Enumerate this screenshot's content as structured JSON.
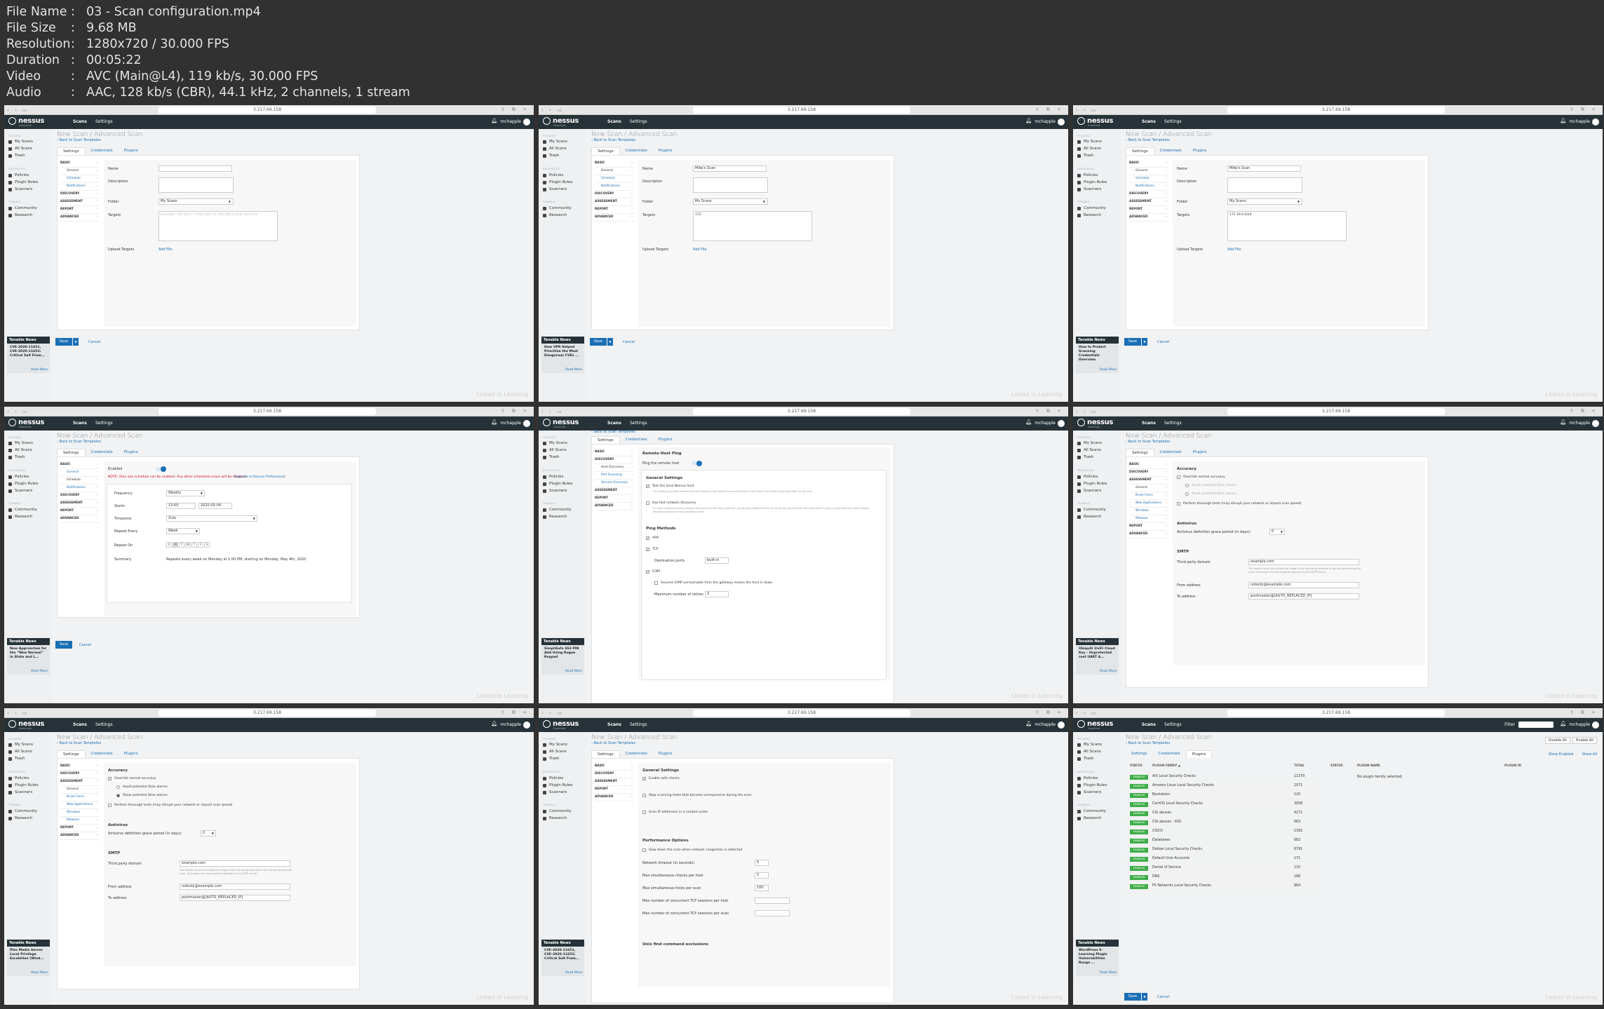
{
  "info": [
    {
      "k": "File Name",
      "v": "03 - Scan configuration.mp4"
    },
    {
      "k": "File Size",
      "v": "9.68 MB"
    },
    {
      "k": "Resolution",
      "v": "1280x720 / 30.000 FPS"
    },
    {
      "k": "Duration",
      "v": "00:05:22"
    },
    {
      "k": "Video",
      "v": "AVC (Main@L4), 119 kb/s, 30.000 FPS"
    },
    {
      "k": "Audio",
      "v": "AAC, 128 kb/s (CBR), 44.1 kHz, 2 channels, 1 stream"
    }
  ],
  "common": {
    "url": "3.217.69.158",
    "brand": "nessus",
    "brand_sub": "Essentials",
    "nav_scans": "Scans",
    "nav_settings": "Settings",
    "user": "mchapple",
    "filter": "Filter",
    "folders_h": "FOLDERS",
    "my_scans": "My Scans",
    "all_scans": "All Scans",
    "trash": "Trash",
    "resources_h": "RESOURCES",
    "policies": "Policies",
    "plugin_rules": "Plugin Rules",
    "scanners": "Scanners",
    "tenable_h": "TENABLE",
    "community": "Community",
    "research": "Research",
    "news_h": "Tenable News",
    "read_more": "Read More",
    "page_title": "New Scan / Advanced Scan",
    "back": "‹ Back to Scan Templates",
    "tab_settings": "Settings",
    "tab_credentials": "Credentials",
    "tab_plugins": "Plugins",
    "basic": "BASIC",
    "general": "General",
    "schedule": "Schedule",
    "notifications": "Notifications",
    "discovery": "DISCOVERY",
    "host_discovery": "Host Discovery",
    "port_scanning": "Port Scanning",
    "service_discovery": "Service Discovery",
    "assessment": "ASSESSMENT",
    "brute_force": "Brute Force",
    "web_apps": "Web Applications",
    "windows": "Windows",
    "malware": "Malware",
    "report": "REPORT",
    "advanced": "ADVANCED",
    "name_l": "Name",
    "desc_l": "Description",
    "folder_l": "Folder",
    "folder_v": "My Scans",
    "targets_l": "Targets",
    "targets_ph": "Example: 192.168.1.1-192.168.1.5, 192.168.2.0/24, test.com",
    "upload_l": "Upload Targets",
    "add_file": "Add File",
    "save": "Save",
    "cancel": "Cancel",
    "watermark": "Linked in Learning",
    "accuracy": "Accuracy",
    "override": "Override normal accuracy",
    "avoid_fa": "Avoid potential false alarms",
    "show_fa": "Show potential false alarms",
    "thorough": "Perform thorough tests (may disrupt your network or impact scan speed)",
    "antivirus": "Antivirus",
    "av_grace": "Antivirus definition grace period (in days):",
    "av_val": "0",
    "smtp": "SMTP",
    "third_party": "Third party domain",
    "third_party_v": "example.com",
    "smtp_note": "The domain must be outside the range of the site being scanned or the site performing the scan. Otherwise, the test might be aborted by the SMTP server.",
    "from_l": "From address",
    "from_v": "nobody@example.com",
    "to_l": "To address",
    "to_v": "postmaster@[AUTO_REPLACED_IP]"
  },
  "f1": {
    "news": "CVE-2020-11651, CVE-2020-11652: Critical Salt Fram..."
  },
  "f2": {
    "name_v": "Mike's Scan",
    "targets_v": "172",
    "news": "How VPR Helped Prioritize the Most Dangerous CVEs ..."
  },
  "f3": {
    "name_v": "Mike's Scan",
    "targets_v": "172.30.0.0/24",
    "news": "How to Protect Scanning Credentials Overview"
  },
  "f4": {
    "enabled": "Enabled",
    "warn": "NOTE: Only one schedule can be enabled. Any other scheduled scans will be disabled.",
    "upgrade": "Upgrade to Nessus Professional",
    "freq_l": "Frequency",
    "freq_v": "Weekly",
    "starts_l": "Starts",
    "starts_t": "13:00",
    "starts_d": "2020-05-04",
    "tz_l": "Timezone",
    "tz_v": "Zulu",
    "repeat_l": "Repeat Every",
    "repeat_v": "Week",
    "repeat_on_l": "Repeat On",
    "days": [
      "S",
      "M",
      "T",
      "W",
      "T",
      "F",
      "S"
    ],
    "summary_l": "Summary",
    "summary_v": "Repeats every week on Monday at 1:00 PM, starting on Monday, May 4th, 2020",
    "news": "New Approaches for the “New Normal” in State and L..."
  },
  "f5": {
    "rhp": "Remote Host Ping",
    "ping_remote": "Ping the remote host",
    "gen_settings": "General Settings",
    "test_local": "Test the local Nessus host",
    "test_local_note": "This setting specifies whether the local Nessus host should be scanned when it falls within the target range specified for the scan.",
    "fast_disc": "Use fast network discovery",
    "fast_note": "If a host responds to ping, Nessus attempts to avoid false positives, performing additional tests to verify the response did not come from a proxy or load balancer. Fast network discovery bypasses those additional tests.",
    "ping_methods": "Ping Methods",
    "arp": "ARP",
    "tcp": "TCP",
    "dest_ports": "Destination ports",
    "dest_ports_v": "built-in",
    "icmp": "ICMP",
    "assume_icmp": "Assume ICMP unreachable from the gateway means the host is down",
    "max_retries": "Maximum number of retries",
    "max_retries_v": "2",
    "news": "SimpliSafe SS3 PIN Add Using Rogue Keypad"
  },
  "f6": {
    "news": "Ubiquiti UniFi Cloud Key - Unprotected root UART A..."
  },
  "f7": {
    "news": "Plex Media Server Local Privilege Escalation (Wind..."
  },
  "f8": {
    "gen_settings": "General Settings",
    "safe_checks": "Enable safe checks",
    "stop_unresp": "Stop scanning hosts that become unresponsive during the scan",
    "random_order": "Scan IP addresses in a random order",
    "perf": "Performance Options",
    "slow_down": "Slow down the scan when network congestion is detected",
    "net_timeout": "Network timeout (in seconds)",
    "net_timeout_v": "5",
    "max_checks": "Max simultaneous checks per host",
    "max_checks_v": "5",
    "max_hosts": "Max simultaneous hosts per scan",
    "max_hosts_v": "100",
    "max_tcp_host": "Max number of concurrent TCP sessions per host",
    "max_tcp_scan": "Max number of concurrent TCP sessions per scan",
    "unix_excl": "Unix find command exclusions",
    "news": "CVE-2020-11651, CVE-2020-11652: Critical Salt Fram..."
  },
  "f9": {
    "disable_all": "Disable All",
    "enable_all": "Enable All",
    "show_enabled": "Show Enabled",
    "show_all": "Show All",
    "h_status": "STATUS",
    "h_family": "PLUGIN FAMILY ▲",
    "h_total": "TOTAL",
    "h_status2": "STATUS",
    "h_name": "PLUGIN NAME",
    "h_id": "PLUGIN ID",
    "no_family": "No plugin family selected.",
    "enabled": "ENABLED",
    "rows": [
      {
        "fam": "AIX Local Security Checks",
        "tot": "11370"
      },
      {
        "fam": "Amazon Linux Local Security Checks",
        "tot": "1071"
      },
      {
        "fam": "Backdoors",
        "tot": "120"
      },
      {
        "fam": "CentOS Local Security Checks",
        "tot": "3058"
      },
      {
        "fam": "CGI abuses",
        "tot": "4271"
      },
      {
        "fam": "CGI abuses : XSS",
        "tot": "663"
      },
      {
        "fam": "CISCO",
        "tot": "1392"
      },
      {
        "fam": "Databases",
        "tot": "682"
      },
      {
        "fam": "Debian Local Security Checks",
        "tot": "6791"
      },
      {
        "fam": "Default Unix Accounts",
        "tot": "171"
      },
      {
        "fam": "Denial of Service",
        "tot": "110"
      },
      {
        "fam": "DNS",
        "tot": "188"
      },
      {
        "fam": "F5 Networks Local Security Checks",
        "tot": "864"
      }
    ],
    "news": "WordPress E-Learning Plugin Vulnerabilities Range ..."
  },
  "colors": {
    "brand_bar": "#263238",
    "link": "#1a6fb5",
    "enabled_green": "#3fae49"
  }
}
